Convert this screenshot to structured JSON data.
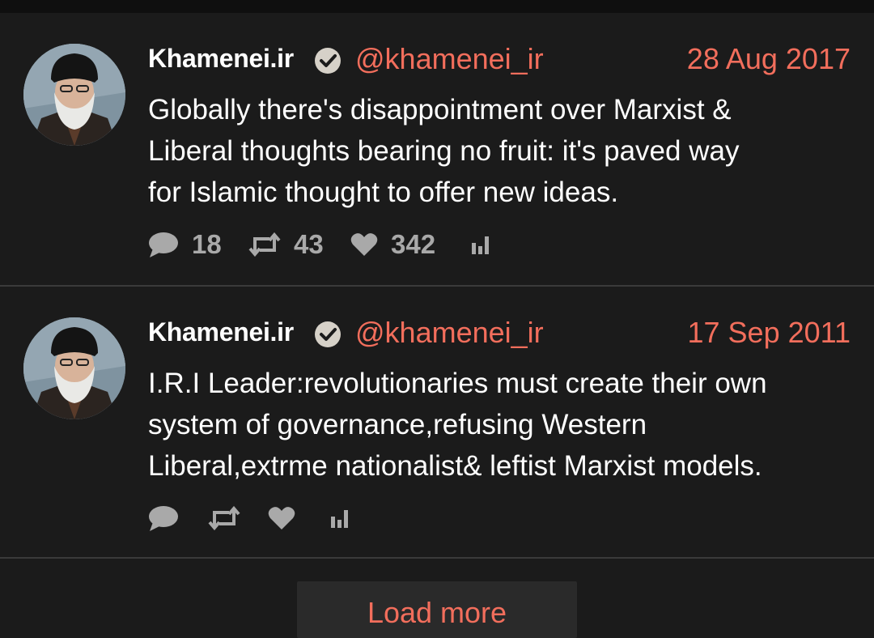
{
  "tweets": [
    {
      "name": "Khamenei.ir",
      "handle": "@khamenei_ir",
      "date": "28 Aug 2017",
      "text_lines": [
        "Globally there's disappointment over Marxist &",
        "Liberal thoughts bearing no fruit: it's paved way",
        "for Islamic thought to offer new ideas."
      ],
      "replies": "18",
      "retweets": "43",
      "likes": "342"
    },
    {
      "name": "Khamenei.ir",
      "handle": "@khamenei_ir",
      "date": "17 Sep 2011",
      "text_lines": [
        "I.R.I Leader:revolutionaries must create their own",
        "system of governance,refusing Western",
        "Liberal,extrme nationalist& leftist Marxist models."
      ],
      "replies": "",
      "retweets": "",
      "likes": ""
    }
  ],
  "load_more_label": "Load more",
  "colors": {
    "background": "#1b1b1b",
    "accent": "#f26e5c",
    "muted": "#a9a9a9",
    "text": "#ffffff"
  },
  "icons": [
    "verified-icon",
    "reply-icon",
    "retweet-icon",
    "like-icon",
    "analytics-icon"
  ]
}
